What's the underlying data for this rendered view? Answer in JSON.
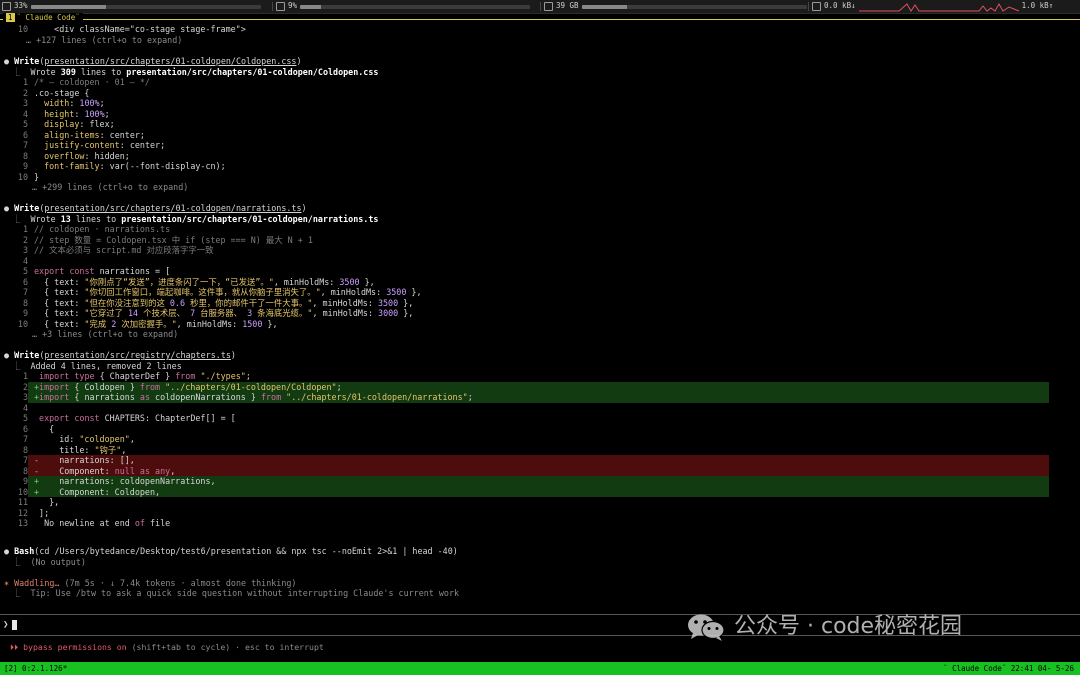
{
  "statusbar": {
    "cpu": "33%",
    "cpu_fill": 0.33,
    "mem": "9%",
    "mem_fill": 0.09,
    "disk": "39 GB",
    "disk_fill": 0.2,
    "net_down": "0.0 kB↓",
    "net_up": "1.0 kB↑",
    "icons": [
      "cpu-icon",
      "memory-icon",
      "disk-icon",
      "network-icon"
    ]
  },
  "title": {
    "number": "1",
    "text": "¨ Claude Code¨"
  },
  "transcript": {
    "top": {
      "line10_num": "10",
      "line10_code": "    <div className=\"co-stage stage-frame\">",
      "more": "… +127 lines (ctrl+o to expand)"
    },
    "write1": {
      "tool": "Write",
      "arg": "presentation/src/chapters/01-coldopen/Coldopen.css",
      "summary_prefix": "Wrote ",
      "summary_count": "309",
      "summary_mid": " lines to ",
      "summary_path": "presentation/src/chapters/01-coldopen/Coldopen.css",
      "lines": [
        {
          "n": "1",
          "t": "/* — coldopen · 01 — */"
        },
        {
          "n": "2",
          "t": ".co-stage {"
        },
        {
          "n": "3",
          "t": "  width: 100%;"
        },
        {
          "n": "4",
          "t": "  height: 100%;"
        },
        {
          "n": "5",
          "t": "  display: flex;"
        },
        {
          "n": "6",
          "t": "  align-items: center;"
        },
        {
          "n": "7",
          "t": "  justify-content: center;"
        },
        {
          "n": "8",
          "t": "  overflow: hidden;"
        },
        {
          "n": "9",
          "t": "  font-family: var(--font-display-cn);"
        },
        {
          "n": "10",
          "t": "}"
        }
      ],
      "more": "… +299 lines (ctrl+o to expand)"
    },
    "write2": {
      "tool": "Write",
      "arg": "presentation/src/chapters/01-coldopen/narrations.ts",
      "summary_prefix": "Wrote ",
      "summary_count": "13",
      "summary_mid": " lines to ",
      "summary_path": "presentation/src/chapters/01-coldopen/narrations.ts",
      "lines": [
        {
          "n": "1",
          "t": "// coldopen · narrations.ts"
        },
        {
          "n": "2",
          "t": "// step 数量 = Coldopen.tsx 中 if (step === N) 最大 N + 1"
        },
        {
          "n": "3",
          "t": "// 文本必须与 script.md 对应段落字字一致"
        },
        {
          "n": "4",
          "t": ""
        },
        {
          "n": "5",
          "t": "export const narrations = ["
        },
        {
          "n": "6",
          "t": "  { text: \"你刚点了“发送”，进度条闪了一下，“已发送”。\", minHoldMs: 3500 },"
        },
        {
          "n": "7",
          "t": "  { text: \"你切回工作窗口，端起咖啡。这件事，就从你脑子里消失了。\", minHoldMs: 3500 },"
        },
        {
          "n": "8",
          "t": "  { text: \"但在你没注意到的这 0.6 秒里，你的邮件干了一件大事。\", minHoldMs: 3500 },"
        },
        {
          "n": "9",
          "t": "  { text: \"它穿过了 14 个技术层、 7 台服务器、 3 条海底光缆。\", minHoldMs: 3000 },"
        },
        {
          "n": "10",
          "t": "  { text: \"完成 2 次加密握手。\", minHoldMs: 1500 },"
        }
      ],
      "more": "… +3 lines (ctrl+o to expand)"
    },
    "write3": {
      "tool": "Write",
      "arg": "presentation/src/registry/chapters.ts",
      "summary": "Added 4 lines, removed 2 lines",
      "lines": [
        {
          "n": "1",
          "m": " ",
          "t": "import type { ChapterDef } from \"./types\";",
          "k": "ctx"
        },
        {
          "n": "2",
          "m": "+",
          "t": "import { Coldopen } from \"../chapters/01-coldopen/Coldopen\";",
          "k": "add"
        },
        {
          "n": "3",
          "m": "+",
          "t": "import { narrations as coldopenNarrations } from \"../chapters/01-coldopen/narrations\";",
          "k": "add"
        },
        {
          "n": "4",
          "m": " ",
          "t": "",
          "k": "ctx"
        },
        {
          "n": "5",
          "m": " ",
          "t": "export const CHAPTERS: ChapterDef[] = [",
          "k": "ctx"
        },
        {
          "n": "6",
          "m": " ",
          "t": "  {",
          "k": "ctx"
        },
        {
          "n": "7",
          "m": " ",
          "t": "    id: \"coldopen\",",
          "k": "ctx"
        },
        {
          "n": "8",
          "m": " ",
          "t": "    title: \"钩子\",",
          "k": "ctx"
        },
        {
          "n": "7",
          "m": "-",
          "t": "    narrations: [],",
          "k": "del"
        },
        {
          "n": "8",
          "m": "-",
          "t": "    Component: null as any,",
          "k": "del"
        },
        {
          "n": "9",
          "m": "+",
          "t": "    narrations: coldopenNarrations,",
          "k": "add"
        },
        {
          "n": "10",
          "m": "+",
          "t": "    Component: Coldopen,",
          "k": "add"
        },
        {
          "n": "11",
          "m": " ",
          "t": "  },",
          "k": "ctx"
        },
        {
          "n": "12",
          "m": " ",
          "t": "];",
          "k": "ctx"
        },
        {
          "n": "13",
          "m": " ",
          "t": " No newline at end of file",
          "k": "ctx"
        }
      ]
    },
    "bash": {
      "tool": "Bash",
      "arg": "cd /Users/bytedance/Desktop/test6/presentation && npx tsc --noEmit 2>&1 | head -40",
      "output": "(No output)"
    },
    "thinking": {
      "label": "Waddling…",
      "meta": " (7m 5s · ↓ 7.4k tokens · almost done thinking)",
      "tip": "Tip: Use /btw to ask a quick side question without interrupting Claude's current work"
    }
  },
  "input": {
    "prompt_symbol": "❯",
    "permissions_arrows": "⏵⏵",
    "permissions_on": " bypass permissions on",
    "permissions_hint": " (shift+tab to cycle) · esc to interrupt"
  },
  "watermark": {
    "text": "公众号 · code秘密花园"
  },
  "bottombar": {
    "left": "[2] 0:2.1.126*",
    "right": "¨ Claude Code¨ 22:41 04- 5-26"
  }
}
